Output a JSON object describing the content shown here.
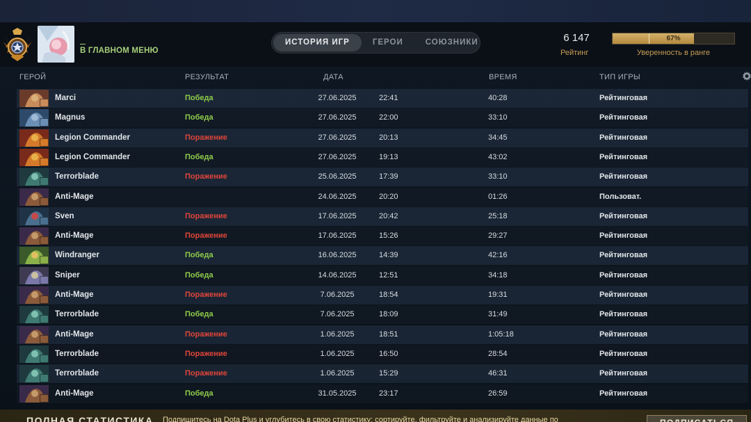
{
  "header": {
    "back_label": "В ГЛАВНОМ МЕНЮ",
    "tabs": [
      {
        "label": "ИСТОРИЯ ИГР",
        "active": true
      },
      {
        "label": "ГЕРОИ",
        "active": false
      },
      {
        "label": "СОЮЗНИКИ",
        "active": false
      }
    ],
    "rating_value": "6 147",
    "rating_label": "Рейтинг",
    "confidence_percent": 67,
    "confidence_text": "67%",
    "confidence_label": "Уверенность в ранге"
  },
  "columns": {
    "hero": "ГЕРОЙ",
    "result": "РЕЗУЛЬТАТ",
    "date": "ДАТА",
    "duration": "ВРЕМЯ",
    "mode": "ТИП ИГРЫ"
  },
  "colors": {
    "win": "#8fcd4a",
    "loss": "#e0453a",
    "accent_gold": "#c79d54",
    "back_green": "#a6cf7a"
  },
  "matches": [
    {
      "hero": "Marci",
      "result": "Победа",
      "outcome": "win",
      "date": "27.06.2025",
      "time": "22:41",
      "duration": "40:28",
      "mode": "Рейтинговая"
    },
    {
      "hero": "Magnus",
      "result": "Победа",
      "outcome": "win",
      "date": "27.06.2025",
      "time": "22:00",
      "duration": "33:10",
      "mode": "Рейтинговая"
    },
    {
      "hero": "Legion Commander",
      "result": "Поражение",
      "outcome": "loss",
      "date": "27.06.2025",
      "time": "20:13",
      "duration": "34:45",
      "mode": "Рейтинговая"
    },
    {
      "hero": "Legion Commander",
      "result": "Победа",
      "outcome": "win",
      "date": "27.06.2025",
      "time": "19:13",
      "duration": "43:02",
      "mode": "Рейтинговая"
    },
    {
      "hero": "Terrorblade",
      "result": "Поражение",
      "outcome": "loss",
      "date": "25.06.2025",
      "time": "17:39",
      "duration": "33:10",
      "mode": "Рейтинговая"
    },
    {
      "hero": "Anti-Mage",
      "result": "",
      "outcome": "none",
      "date": "24.06.2025",
      "time": "20:20",
      "duration": "01:26",
      "mode": "Пользоват."
    },
    {
      "hero": "Sven",
      "result": "Поражение",
      "outcome": "loss",
      "date": "17.06.2025",
      "time": "20:42",
      "duration": "25:18",
      "mode": "Рейтинговая"
    },
    {
      "hero": "Anti-Mage",
      "result": "Поражение",
      "outcome": "loss",
      "date": "17.06.2025",
      "time": "15:26",
      "duration": "29:27",
      "mode": "Рейтинговая"
    },
    {
      "hero": "Windranger",
      "result": "Победа",
      "outcome": "win",
      "date": "16.06.2025",
      "time": "14:39",
      "duration": "42:16",
      "mode": "Рейтинговая"
    },
    {
      "hero": "Sniper",
      "result": "Победа",
      "outcome": "win",
      "date": "14.06.2025",
      "time": "12:51",
      "duration": "34:18",
      "mode": "Рейтинговая"
    },
    {
      "hero": "Anti-Mage",
      "result": "Поражение",
      "outcome": "loss",
      "date": "7.06.2025",
      "time": "18:54",
      "duration": "19:31",
      "mode": "Рейтинговая"
    },
    {
      "hero": "Terrorblade",
      "result": "Победа",
      "outcome": "win",
      "date": "7.06.2025",
      "time": "18:09",
      "duration": "31:49",
      "mode": "Рейтинговая"
    },
    {
      "hero": "Anti-Mage",
      "result": "Поражение",
      "outcome": "loss",
      "date": "1.06.2025",
      "time": "18:51",
      "duration": "1:05:18",
      "mode": "Рейтинговая"
    },
    {
      "hero": "Terrorblade",
      "result": "Поражение",
      "outcome": "loss",
      "date": "1.06.2025",
      "time": "16:50",
      "duration": "28:54",
      "mode": "Рейтинговая"
    },
    {
      "hero": "Terrorblade",
      "result": "Поражение",
      "outcome": "loss",
      "date": "1.06.2025",
      "time": "15:29",
      "duration": "46:31",
      "mode": "Рейтинговая"
    },
    {
      "hero": "Anti-Mage",
      "result": "Победа",
      "outcome": "win",
      "date": "31.05.2025",
      "time": "23:17",
      "duration": "26:59",
      "mode": "Рейтинговая"
    }
  ],
  "footer": {
    "title": "ПОЛНАЯ СТАТИСТИКА",
    "description": "Подпишитесь на Dota Plus и углубитесь в свою статистику: сортируйте, фильтруйте и анализируйте данные по",
    "button_label": "ПОДПИСАТЬСЯ"
  }
}
